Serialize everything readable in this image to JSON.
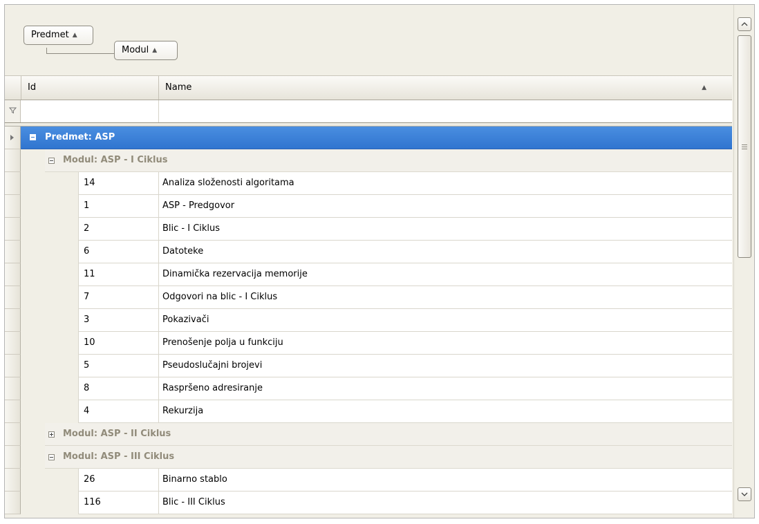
{
  "group_panel": {
    "chips": [
      {
        "label": "Predmet",
        "sort": "▲"
      },
      {
        "label": "Modul",
        "sort": "▲"
      }
    ]
  },
  "columns": {
    "id": {
      "label": "Id"
    },
    "name": {
      "label": "Name",
      "sort": "▲"
    }
  },
  "rows": [
    {
      "type": "group1",
      "label": "Predmet: ASP",
      "expanded": true
    },
    {
      "type": "group2",
      "label": "Modul: ASP - I Ciklus",
      "expanded": true
    },
    {
      "type": "data",
      "id": "14",
      "name": "Analiza složenosti algoritama"
    },
    {
      "type": "data",
      "id": "1",
      "name": "ASP - Predgovor"
    },
    {
      "type": "data",
      "id": "2",
      "name": "Blic - I Ciklus"
    },
    {
      "type": "data",
      "id": "6",
      "name": "Datoteke"
    },
    {
      "type": "data",
      "id": "11",
      "name": "Dinamička rezervacija memorije"
    },
    {
      "type": "data",
      "id": "7",
      "name": "Odgovori na blic - I Ciklus"
    },
    {
      "type": "data",
      "id": "3",
      "name": "Pokazivači"
    },
    {
      "type": "data",
      "id": "10",
      "name": "Prenošenje polja u funkciju"
    },
    {
      "type": "data",
      "id": "5",
      "name": "Pseudoslučajni brojevi"
    },
    {
      "type": "data",
      "id": "8",
      "name": "Raspršeno adresiranje"
    },
    {
      "type": "data",
      "id": "4",
      "name": "Rekurzija"
    },
    {
      "type": "group2",
      "label": "Modul: ASP - II Ciklus",
      "expanded": false
    },
    {
      "type": "group2",
      "label": "Modul: ASP - III Ciklus",
      "expanded": true
    },
    {
      "type": "data",
      "id": "26",
      "name": "Binarno stablo"
    },
    {
      "type": "data",
      "id": "116",
      "name": "Blic - III Ciklus"
    }
  ],
  "colors": {
    "selected_group": "#2f74cf",
    "group_text": "#918b7a",
    "background": "#f1efe6"
  }
}
